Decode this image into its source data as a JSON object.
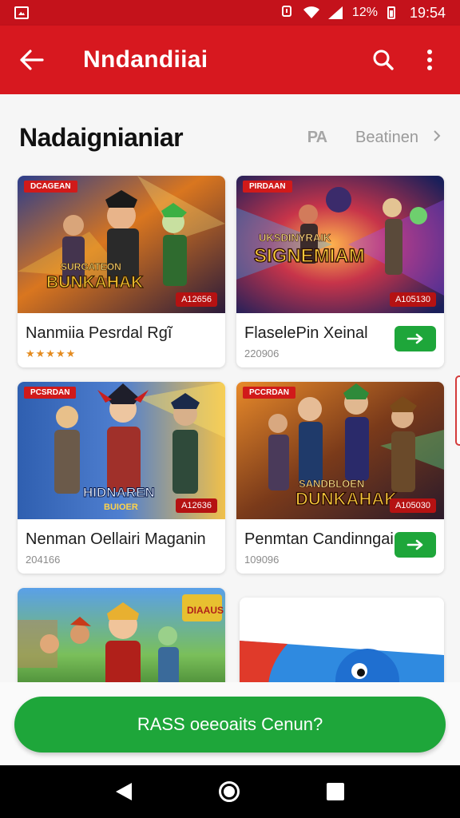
{
  "status_bar": {
    "battery_text": "12%",
    "time": "19:54"
  },
  "app_bar": {
    "title": "Nndandiiai",
    "back_icon": "arrow-left-icon",
    "search_icon": "search-icon",
    "menu_icon": "more-vert-icon"
  },
  "section": {
    "title": "Nadaignianiar",
    "badge": "PA",
    "more_label": "Beatinen"
  },
  "cards": [
    {
      "tag": "DCAGEAN",
      "price": "A12656",
      "art": "BUNKAHAK",
      "art_sub": "SURGATEON",
      "name": "Nanmiia Pesrdal Rgĩ",
      "stars": "★★★★★",
      "has_button": false
    },
    {
      "tag": "PIRDAAN",
      "price": "A105130",
      "art": "SIGNEMIAM",
      "art_sub": "UKSDINYRAIK",
      "name": "FlaselePin Xeinal",
      "meta": "220906",
      "has_button": true
    },
    {
      "tag": "PCSRDAN",
      "price": "A12636",
      "art": "HIDNAREN",
      "art_sub": "BUIOER",
      "name": "Nenman Oellairi Maganin",
      "meta": "204166",
      "has_button": false
    },
    {
      "tag": "PCCRDAN",
      "price": "A105030",
      "art": "DUNKAHAK",
      "art_sub": "SANDBLOEN",
      "name": "Penmtan Candinngai",
      "meta": "109096",
      "has_button": true
    },
    {
      "tag": "",
      "art": "DIAAUS",
      "art_sub": ""
    },
    {
      "tag": "",
      "art": "",
      "art_sub": ""
    }
  ],
  "cta": {
    "label": "RASS oeeoaits Cenun?"
  },
  "colors": {
    "primary_red": "#d7181f",
    "status_red": "#c4121b",
    "green": "#1ea63a"
  }
}
